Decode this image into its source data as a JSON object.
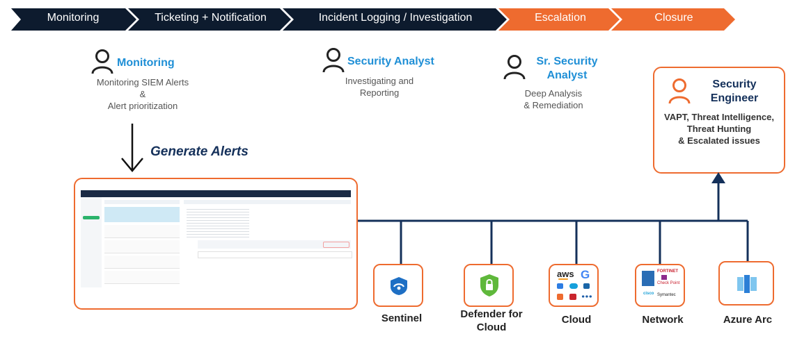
{
  "stages": [
    {
      "label": "Monitoring",
      "color": "#0d1b2e"
    },
    {
      "label": "Ticketing + Notification",
      "color": "#0d1b2e"
    },
    {
      "label": "Incident Logging / Investigation",
      "color": "#0d1b2e"
    },
    {
      "label": "Escalation",
      "color": "#ee6b2f"
    },
    {
      "label": "Closure",
      "color": "#ee6b2f"
    }
  ],
  "roles": {
    "monitoring": {
      "title": "Monitoring",
      "desc1": "Monitoring SIEM Alerts",
      "desc2": "&",
      "desc3": "Alert prioritization"
    },
    "analyst": {
      "title": "Security Analyst",
      "desc1": "Investigating and",
      "desc2": "Reporting"
    },
    "sr_analyst": {
      "title1": "Sr. Security",
      "title2": "Analyst",
      "desc1": "Deep Analysis",
      "desc2": "& Remediation"
    },
    "engineer": {
      "title1": "Security",
      "title2": "Engineer",
      "desc1": "VAPT, Threat Intelligence,",
      "desc2": "Threat Hunting",
      "desc3": "& Escalated issues"
    }
  },
  "generate_alerts": "Generate Alerts",
  "sources": [
    {
      "label": "Sentinel",
      "icon": "sentinel-icon"
    },
    {
      "label": "Defender for Cloud",
      "icon": "defender-shield-icon"
    },
    {
      "label": "Cloud",
      "icon": "cloud-providers-icon"
    },
    {
      "label": "Network",
      "icon": "network-vendors-icon"
    },
    {
      "label": "Azure Arc",
      "icon": "azure-arc-icon"
    }
  ],
  "cloud_icon_text": {
    "aws": "aws",
    "g": "G"
  },
  "network_icon_text": {
    "fortinet": "FORTINET",
    "checkpoint": "Check Point",
    "cisco": "cisco",
    "symantec": "Symantec"
  },
  "colors": {
    "navy": "#0d1b2e",
    "orange": "#ee6b2f",
    "blue": "#1f8fd6",
    "line": "#14305a"
  }
}
